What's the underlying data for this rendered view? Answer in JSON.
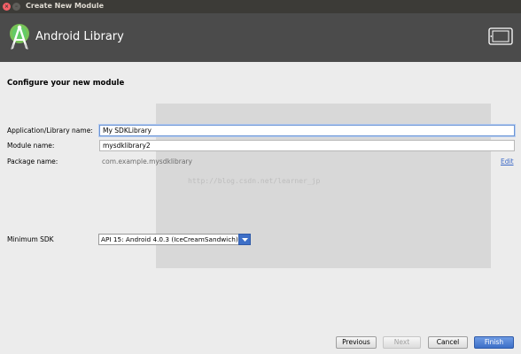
{
  "window": {
    "title": "Create New Module",
    "close_glyph": "×",
    "minimize_glyph": "–"
  },
  "banner": {
    "title": "Android Library",
    "logo_icon": "android-studio-logo-icon",
    "device_icon": "tablet-device-icon"
  },
  "form": {
    "heading": "Configure your new module",
    "app_name_label": "Application/Library name:",
    "app_name_value": "My SDKLibrary",
    "module_name_label": "Module name:",
    "module_name_value": "mysdklibrary2",
    "package_label": "Package name:",
    "package_value": "com.example.mysdklibrary",
    "edit_link": "Edit",
    "min_sdk_label": "Minimum SDK",
    "min_sdk_value": "API 15: Android 4.0.3 (IceCreamSandwich)"
  },
  "watermark": {
    "text": "http://blog.csdn.net/learner_jp"
  },
  "buttons": {
    "previous": "Previous",
    "next": "Next",
    "cancel": "Cancel",
    "finish": "Finish"
  },
  "colors": {
    "accent": "#3d6fc7",
    "banner_bg": "#4b4b4b",
    "titlebar_bg": "#3c3b37"
  }
}
